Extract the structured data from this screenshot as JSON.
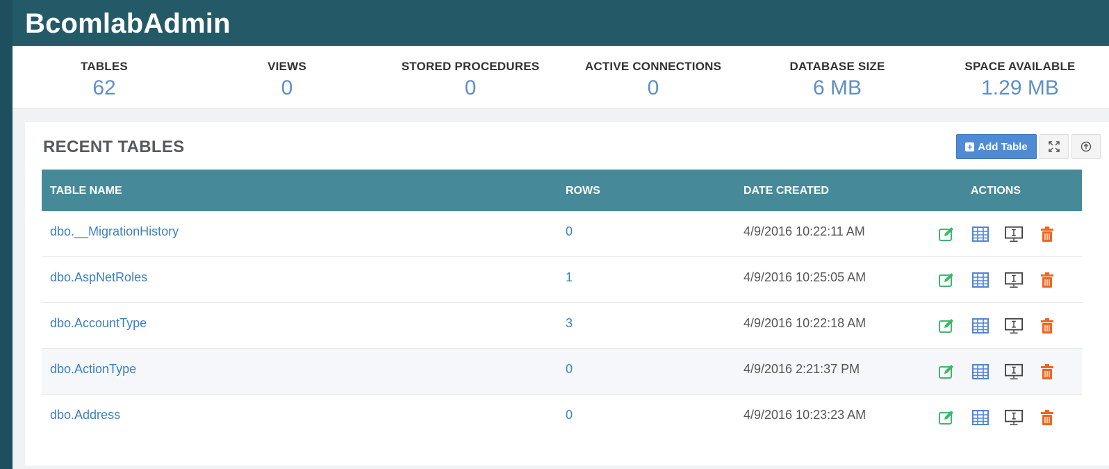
{
  "app": {
    "title": "BcomlabAdmin"
  },
  "stats": [
    {
      "label": "TABLES",
      "value": "62"
    },
    {
      "label": "VIEWS",
      "value": "0"
    },
    {
      "label": "STORED PROCEDURES",
      "value": "0"
    },
    {
      "label": "ACTIVE CONNECTIONS",
      "value": "0"
    },
    {
      "label": "DATABASE SIZE",
      "value": "6 MB"
    },
    {
      "label": "SPACE AVAILABLE",
      "value": "1.29 MB"
    }
  ],
  "panel": {
    "title": "RECENT TABLES",
    "add_button": "Add Table",
    "add_icon": "plus-square-icon",
    "expand_icon": "expand-icon",
    "collapse_icon": "circle-arrow-up-icon"
  },
  "table": {
    "headers": {
      "name": "TABLE NAME",
      "rows": "ROWS",
      "date": "DATE CREATED",
      "actions": "ACTIONS"
    },
    "rows": [
      {
        "name": "dbo.__MigrationHistory",
        "rows": "0",
        "date": "4/9/2016 10:22:11 AM"
      },
      {
        "name": "dbo.AspNetRoles",
        "rows": "1",
        "date": "4/9/2016 10:25:05 AM"
      },
      {
        "name": "dbo.AccountType",
        "rows": "3",
        "date": "4/9/2016 10:22:18 AM"
      },
      {
        "name": "dbo.ActionType",
        "rows": "0",
        "date": "4/9/2016 2:21:37 PM"
      },
      {
        "name": "dbo.Address",
        "rows": "0",
        "date": "4/9/2016 10:23:23 AM"
      }
    ],
    "row_action_icons": [
      "edit-icon",
      "table-grid-icon",
      "monitor-icon",
      "trash-icon"
    ]
  },
  "colors": {
    "header_bg": "#245a67",
    "table_header_bg": "#468a9a",
    "link": "#3d7fc4",
    "stat_value": "#5e8fc7",
    "edit": "#3db86b",
    "grid": "#4f84d6",
    "monitor": "#444444",
    "trash": "#f0661c"
  }
}
